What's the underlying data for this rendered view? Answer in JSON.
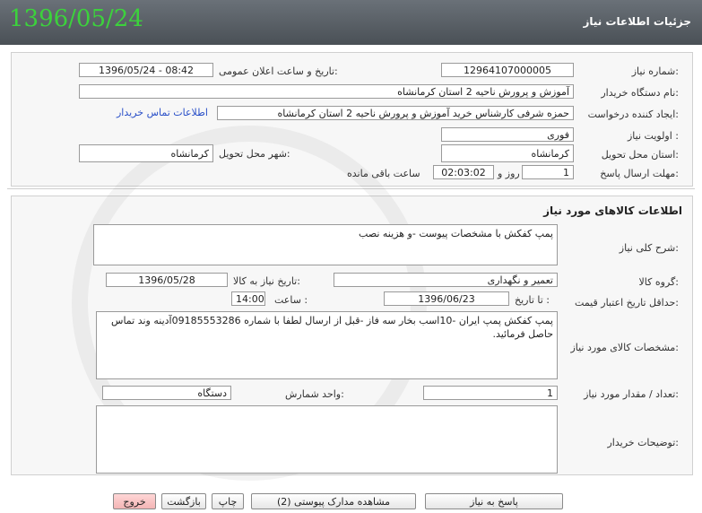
{
  "header": {
    "date": "1396/05/24",
    "title": "جزئیات اطلاعات نیاز"
  },
  "general": {
    "need_number_label": "شماره نیاز:",
    "need_number": "12964107000005",
    "announce_label": "تاریخ و ساعت اعلان عمومی:",
    "announce_value": "1396/05/24 - 08:42",
    "buyer_label": "نام دستگاه خریدار:",
    "buyer_value": "آموزش و پرورش ناحیه 2 استان کرمانشاه",
    "creator_label": "ایجاد کننده درخواست:",
    "creator_value": "حمزه شرفی کارشناس خرید آموزش و پرورش ناحیه 2 استان کرمانشاه",
    "contact_link": "اطلاعات تماس خریدار",
    "priority_label": "اولویت نیاز :",
    "priority_value": "فوری",
    "province_label": "استان محل تحویل:",
    "province_value": "کرمانشاه",
    "city_label": "شهر محل تحویل:",
    "city_value": "کرمانشاه",
    "deadline_label": "مهلت ارسال پاسخ:",
    "days_value": "1",
    "days_label": "روز و",
    "time_value": "02:03:02",
    "remaining_label": "ساعت باقی مانده"
  },
  "goods": {
    "section_title": "اطلاعات کالاهای مورد نیاز",
    "summary_label": "شرح کلی نیاز:",
    "summary_value": "پمپ کفکش با مشخصات پیوست -و هزینه نصب",
    "group_label": "گروه کالا:",
    "group_value": "تعمیر و نگهداری",
    "need_date_label": "تاریخ نیاز به کالا:",
    "need_date_value": "1396/05/28",
    "validity_label": "حداقل تاریخ اعتبار قیمت:",
    "to_date_label": "تا تاریخ :",
    "to_date_value": "1396/06/23",
    "hour_label": "ساعت :",
    "hour_value": "14:00",
    "specs_label": "مشخصات کالای مورد نیاز:",
    "specs_value": "پمپ کفکش پمپ ایران -10اسب بخار سه فاز -قبل از ارسال لطفا با شماره 09185553286آدینه وند تماس حاصل فرمائید.",
    "qty_label": "تعداد / مقدار مورد نیاز:",
    "qty_value": "1",
    "unit_label": "واحد شمارش:",
    "unit_value": "دستگاه",
    "buyer_notes_label": "توضیحات خریدار:",
    "buyer_notes_value": ""
  },
  "buttons": {
    "reply": "پاسخ به نیاز",
    "attachments": "مشاهده مدارک پیوستی (2)",
    "print": "چاپ",
    "back": "بازگشت",
    "exit": "خروج"
  }
}
